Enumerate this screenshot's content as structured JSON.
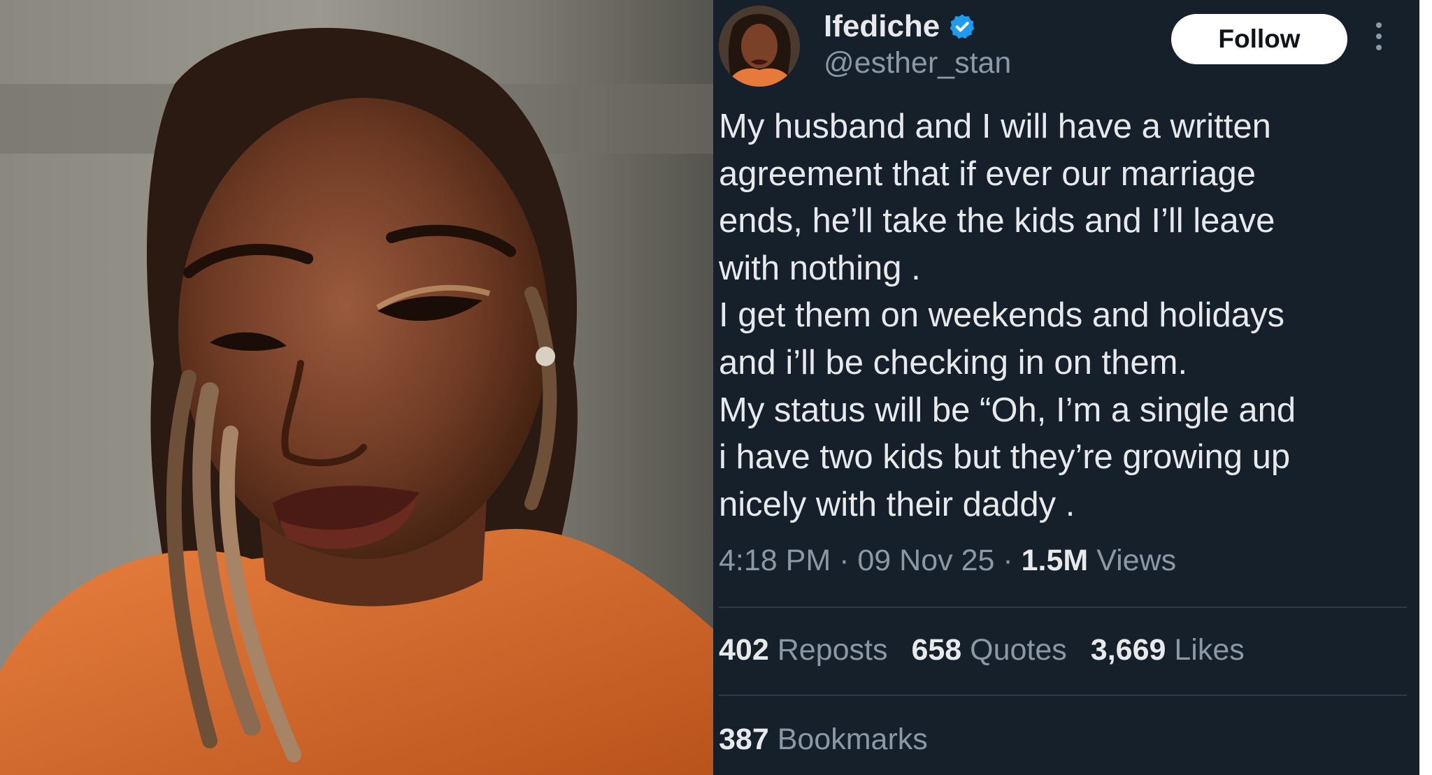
{
  "tweet": {
    "author": {
      "display_name": "Ifediche",
      "handle": "@esther_stan",
      "verified": true
    },
    "follow_label": "Follow",
    "text_lines": [
      "My husband and I will have a written",
      "agreement that if ever our marriage",
      "ends, he’ll take the kids and I’ll leave",
      "with nothing .",
      "I get them on weekends and holidays",
      "and i’ll be checking in on them.",
      "My status will be “Oh, I’m a single and",
      "i have two kids but they’re growing up",
      "nicely with their daddy ."
    ],
    "time": "4:18 PM",
    "separator": "·",
    "date": "09 Nov 25",
    "views_count": "1.5M",
    "views_label": "Views",
    "stats": {
      "reposts_count": "402",
      "reposts_label": "Reposts",
      "quotes_count": "658",
      "quotes_label": "Quotes",
      "likes_count": "3,669",
      "likes_label": "Likes",
      "bookmarks_count": "387",
      "bookmarks_label": "Bookmarks"
    }
  },
  "icons": {
    "verified": "verified-badge-icon",
    "more": "more-options-icon"
  },
  "colors": {
    "background": "#15202b",
    "text_primary": "#e7e9ea",
    "text_secondary": "#8b98a5",
    "verified_blue": "#1d9bf0",
    "follow_bg": "#ffffff",
    "photo_top": "#e77a3a"
  }
}
